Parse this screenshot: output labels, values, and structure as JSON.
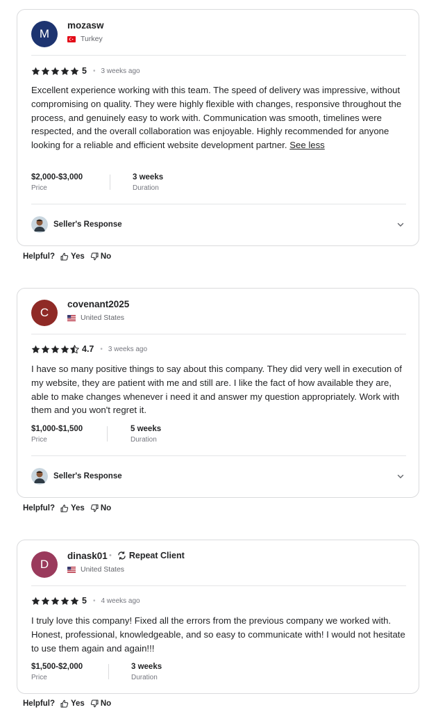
{
  "reviews": [
    {
      "avatar_letter": "M",
      "avatar_color": "#1d3470",
      "username": "mozasw",
      "repeat_client": "",
      "country": "Turkey",
      "stars": 5,
      "score": "5",
      "time_ago": "3 weeks ago",
      "text": "Excellent experience working with this team. The speed of delivery was impressive, without compromising on quality. They were highly flexible with changes, responsive throughout the process, and genuinely easy to work with. Communication was smooth, timelines were respected, and the overall collaboration was enjoyable. Highly recommended for anyone looking for a reliable and efficient website development partner.",
      "see_less": "See less",
      "price": "$2,000-$3,000",
      "price_label": "Price",
      "duration": "3 weeks",
      "duration_label": "Duration",
      "seller_response": "Seller's Response"
    },
    {
      "avatar_letter": "C",
      "avatar_color": "#8f2a26",
      "username": "covenant2025",
      "repeat_client": "",
      "country": "United States",
      "stars": 4.7,
      "score": "4.7",
      "time_ago": "3 weeks ago",
      "text": "I have so many positive things to say about this company. They did very well in execution of my website, they are patient with me and still are. I like the fact of how available they are, able to make changes whenever i need it and answer my question appropriately. Work with them and you won't regret it.",
      "see_less": "",
      "price": "$1,000-$1,500",
      "price_label": "Price",
      "duration": "5 weeks",
      "duration_label": "Duration",
      "seller_response": "Seller's Response"
    },
    {
      "avatar_letter": "D",
      "avatar_color": "#9a3a5c",
      "username": "dinask01",
      "repeat_client": "Repeat Client",
      "country": "United States",
      "stars": 5,
      "score": "5",
      "time_ago": "4 weeks ago",
      "text": "I truly love this company! Fixed all the errors from the previous company we worked with. Honest, professional, knowledgeable, and so easy to communicate with! I would not hesitate to use them again and again!!!",
      "see_less": "",
      "price": "$1,500-$2,000",
      "price_label": "Price",
      "duration": "3 weeks",
      "duration_label": "Duration",
      "seller_response": ""
    }
  ],
  "helpful": {
    "label": "Helpful?",
    "yes": "Yes",
    "no": "No"
  },
  "icons": {
    "star": "star-icon",
    "thumbs_up": "thumbs-up-icon",
    "thumbs_down": "thumbs-down-icon",
    "chevron": "chevron-down-icon",
    "repeat": "repeat-icon"
  }
}
